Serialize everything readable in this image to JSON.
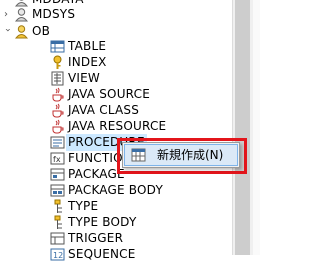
{
  "tree": {
    "top_items": [
      {
        "label": "MDSYS"
      },
      {
        "label": "OB"
      }
    ],
    "partial_top_label": "MDDATA",
    "children": [
      {
        "label": "TABLE",
        "icon": "table-icon"
      },
      {
        "label": "INDEX",
        "icon": "index-icon"
      },
      {
        "label": "VIEW",
        "icon": "view-icon"
      },
      {
        "label": "JAVA SOURCE",
        "icon": "java-source-icon"
      },
      {
        "label": "JAVA CLASS",
        "icon": "java-class-icon"
      },
      {
        "label": "JAVA RESOURCE",
        "icon": "java-resource-icon"
      },
      {
        "label": "PROCEDURE",
        "icon": "procedure-icon"
      },
      {
        "label": "FUNCTION",
        "icon": "function-icon"
      },
      {
        "label": "PACKAGE",
        "icon": "package-icon"
      },
      {
        "label": "PACKAGE BODY",
        "icon": "package-body-icon"
      },
      {
        "label": "TYPE",
        "icon": "type-icon"
      },
      {
        "label": "TYPE BODY",
        "icon": "type-body-icon"
      },
      {
        "label": "TRIGGER",
        "icon": "trigger-icon"
      },
      {
        "label": "SEQUENCE",
        "icon": "sequence-icon"
      }
    ]
  },
  "context_menu": {
    "items": [
      {
        "label": "新規作成(N)",
        "icon": "new-icon"
      }
    ]
  },
  "colors": {
    "highlight_border": "#e3151b",
    "selection": "#cce8ff"
  }
}
